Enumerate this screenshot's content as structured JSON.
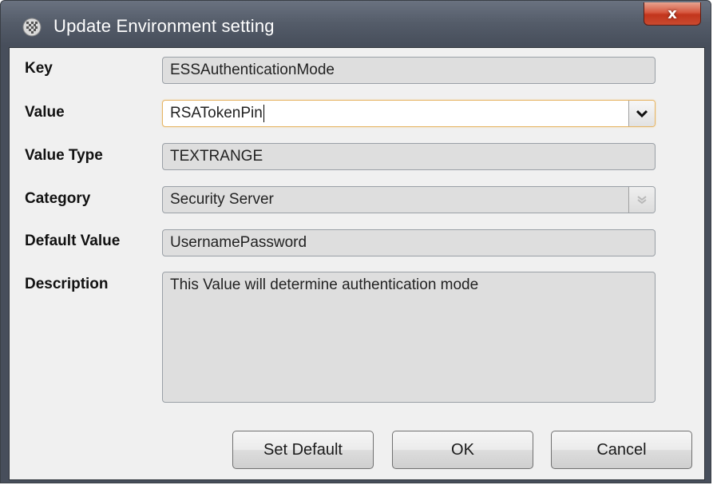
{
  "window": {
    "title": "Update Environment setting",
    "close_symbol": "x"
  },
  "icons": {
    "app": "settings-gear-icon",
    "close": "close-icon",
    "dropdown": "chevron-down-icon"
  },
  "form": {
    "key": {
      "label": "Key",
      "value": "ESSAuthenticationMode"
    },
    "value": {
      "label": "Value",
      "value": "RSATokenPin"
    },
    "value_type": {
      "label": "Value Type",
      "value": "TEXTRANGE"
    },
    "category": {
      "label": "Category",
      "value": "Security Server"
    },
    "default_value": {
      "label": "Default Value",
      "value": "UsernamePassword"
    },
    "description": {
      "label": "Description",
      "value": "This Value will determine authentication mode"
    }
  },
  "buttons": {
    "set_default": "Set Default",
    "ok": "OK",
    "cancel": "Cancel"
  },
  "colors": {
    "title_bar": "#545c69",
    "close_button": "#c94a30",
    "focus_border": "#e6b566",
    "field_background": "#dedede"
  }
}
